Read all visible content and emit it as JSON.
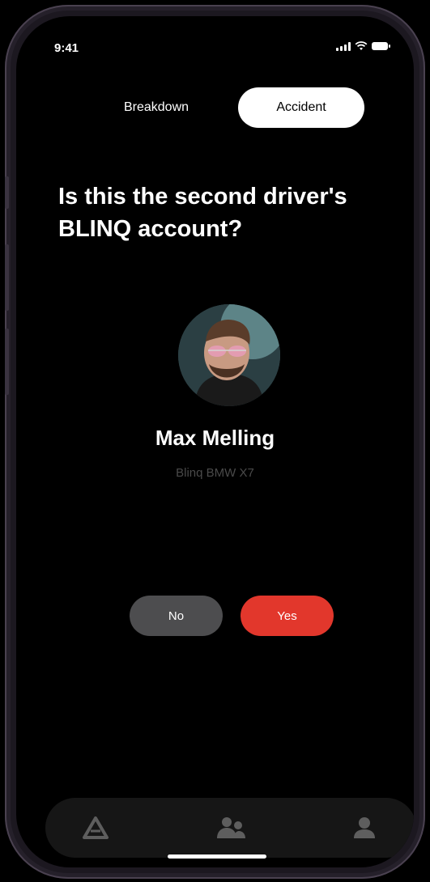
{
  "status_bar": {
    "time": "9:41"
  },
  "tabs": [
    {
      "label": "Breakdown",
      "selected": false
    },
    {
      "label": "Accident",
      "selected": true
    }
  ],
  "question": "Is this the second driver's BLINQ account?",
  "profile": {
    "name": "Max Melling",
    "car": "Blinq BMW X7"
  },
  "actions": {
    "no_label": "No",
    "yes_label": "Yes"
  },
  "bottom_nav": [
    {
      "icon": "blinq-logo-icon"
    },
    {
      "icon": "users-icon"
    },
    {
      "icon": "profile-icon"
    }
  ],
  "colors": {
    "accent": "#e2372c",
    "secondary_button": "#4d4d4f",
    "background": "#000000"
  }
}
